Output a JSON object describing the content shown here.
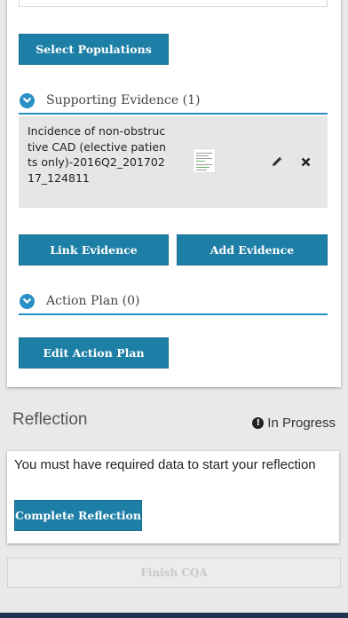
{
  "populations": {
    "select_label": "Select Populations"
  },
  "supporting_evidence": {
    "title": "Supporting Evidence (1)",
    "items": [
      {
        "name": "Incidence of non-obstructive CAD (elective patients only)-2016Q2_20170217_124811",
        "edit_icon": "pencil-icon",
        "remove_icon": "close-icon"
      }
    ],
    "link_label": "Link Evidence",
    "add_label": "Add Evidence"
  },
  "action_plan": {
    "title": "Action Plan (0)",
    "edit_label": "Edit Action Plan"
  },
  "reflection": {
    "title": "Reflection",
    "status": "In Progress",
    "status_icon": "info-icon",
    "message": "You must have required data to start your reflection",
    "complete_label": "Complete Reflection"
  },
  "finish": {
    "label": "Finish CQA"
  },
  "colors": {
    "primary": "#1e7fa6",
    "accent_line": "#2a8fc6",
    "background": "#e9e9e9",
    "footer": "#1f3653"
  }
}
